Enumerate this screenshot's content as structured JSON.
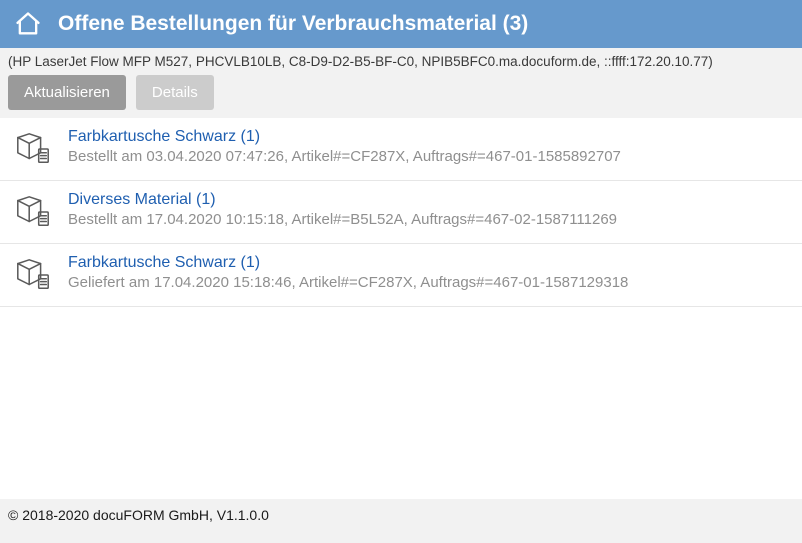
{
  "header": {
    "title": "Offene Bestellungen für Verbrauchsmaterial (3)"
  },
  "device_info": "(HP LaserJet Flow MFP M527, PHCVLB10LB, C8-D9-D2-B5-BF-C0, NPIB5BFC0.ma.docuform.de, ::ffff:172.20.10.77)",
  "toolbar": {
    "refresh_label": "Aktualisieren",
    "details_label": "Details"
  },
  "orders": [
    {
      "title": "Farbkartusche Schwarz (1)",
      "subtitle": "Bestellt am 03.04.2020 07:47:26, Artikel#=CF287X, Auftrags#=467-01-1585892707"
    },
    {
      "title": "Diverses Material (1)",
      "subtitle": "Bestellt am 17.04.2020 10:15:18, Artikel#=B5L52A, Auftrags#=467-02-1587111269"
    },
    {
      "title": "Farbkartusche Schwarz (1)",
      "subtitle": "Geliefert am 17.04.2020 15:18:46, Artikel#=CF287X, Auftrags#=467-01-1587129318"
    }
  ],
  "footer": {
    "text": "© 2018-2020 docuFORM GmbH, V1.1.0.0"
  }
}
